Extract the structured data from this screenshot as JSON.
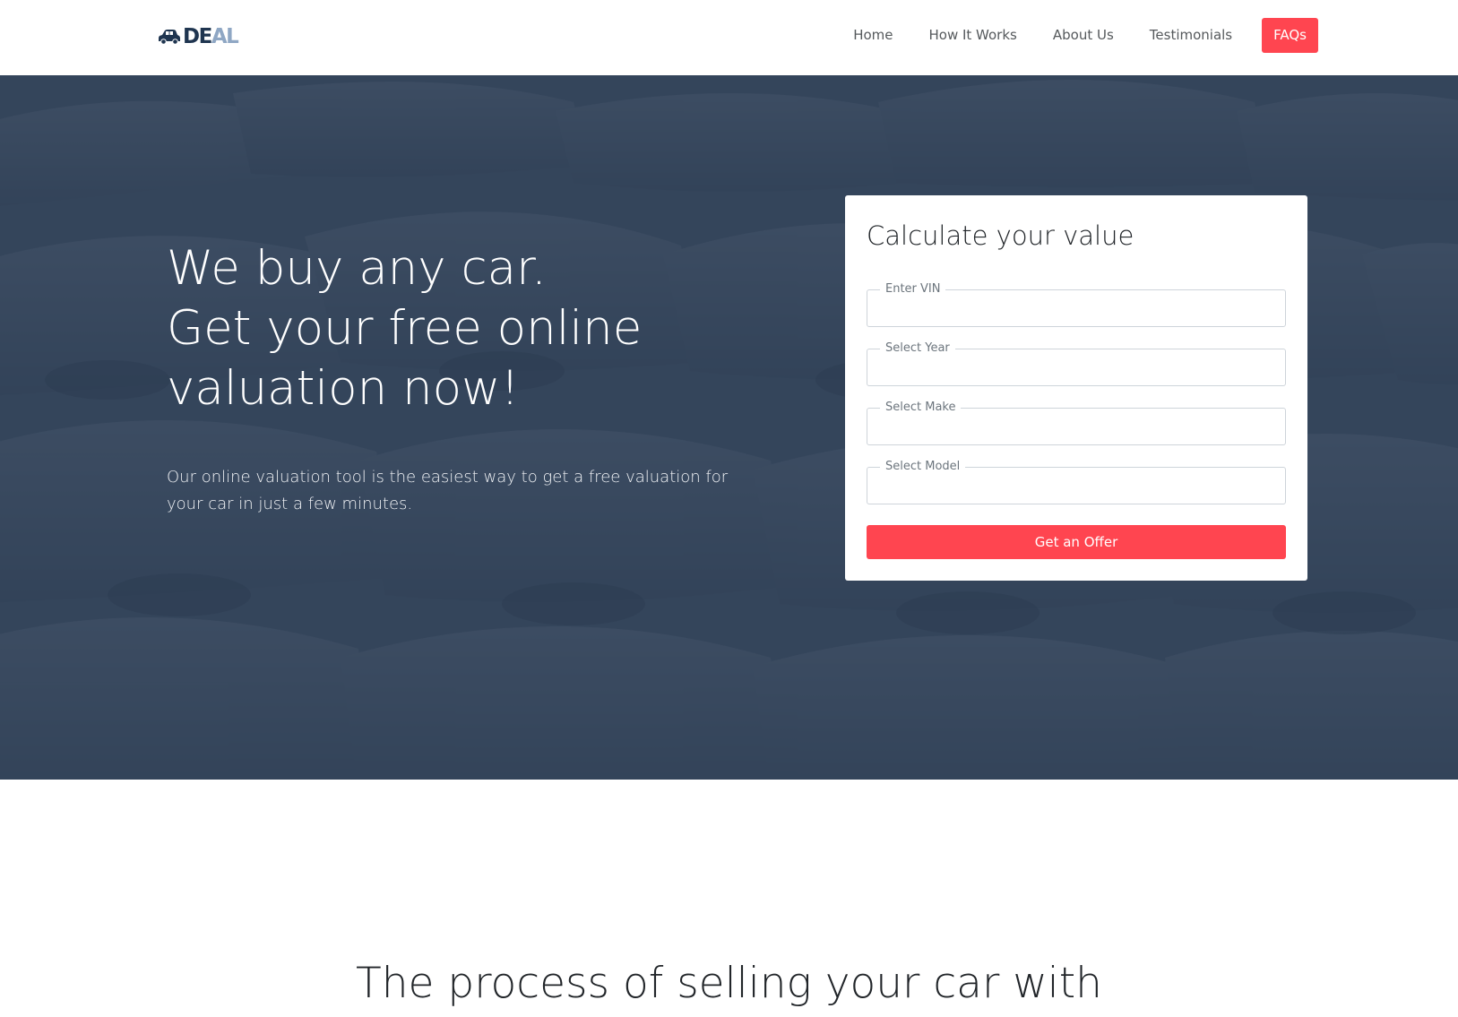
{
  "brand": {
    "logo_dark": "DE",
    "logo_light": "AL",
    "logo_icon": "car-icon",
    "colors": {
      "accent": "#ff4550",
      "brand_dark": "#1f3550",
      "brand_light": "#8fa7c4",
      "hero_overlay": "#2c3e56"
    }
  },
  "nav": {
    "items": [
      {
        "label": "Home"
      },
      {
        "label": "How It Works"
      },
      {
        "label": "About Us"
      },
      {
        "label": "Testimonials"
      }
    ],
    "cta_label": "FAQs"
  },
  "hero": {
    "title_lines": [
      "We buy any car.",
      "Get your free online",
      "valuation now!"
    ],
    "subtitle": "Our online valuation tool is the easiest way to get a free valuation for your car in just a few minutes."
  },
  "form": {
    "title": "Calculate your value",
    "fields": [
      {
        "label": "Enter VIN",
        "value": ""
      },
      {
        "label": "Select Year",
        "value": ""
      },
      {
        "label": "Select Make",
        "value": ""
      },
      {
        "label": "Select Model",
        "value": ""
      }
    ],
    "submit_label": "Get an Offer"
  },
  "process": {
    "title": "The process of selling your car with"
  }
}
